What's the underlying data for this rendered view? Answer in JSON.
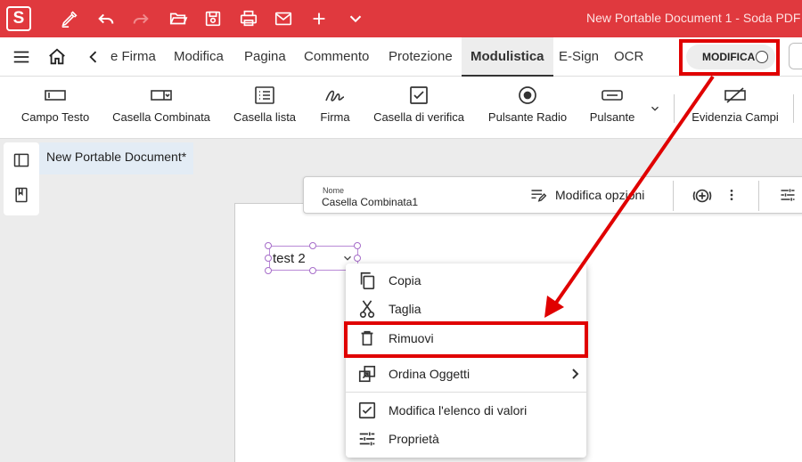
{
  "titlebar": {
    "logo_letter": "S",
    "doc_title": "New Portable Document 1  -  Soda PDF",
    "bg_color": "#e0393e"
  },
  "quick_access": [
    "sign-pen-icon",
    "undo-icon",
    "redo-icon",
    "open-folder-icon",
    "save-icon",
    "print-icon",
    "mail-icon",
    "plus-icon",
    "chevron-down-icon"
  ],
  "menubar": {
    "tabs": [
      "e Firma",
      "Modifica",
      "Pagina",
      "Commento",
      "Protezione",
      "Modulistica",
      "E-Sign",
      "OCR"
    ],
    "active_tab": "Modulistica",
    "mode_toggle_label": "MODIFICA"
  },
  "toolbar": {
    "tools": [
      "Campo Testo",
      "Casella Combinata",
      "Casella lista",
      "Firma",
      "Casella di verifica",
      "Pulsante Radio",
      "Pulsante",
      "Evidenzia Campi"
    ]
  },
  "document": {
    "tab_title": "New Portable Document*"
  },
  "field_properties": {
    "name_label": "Nome",
    "name_value": "Casella Combinata1",
    "edit_options_label": "Modifica opzioni"
  },
  "combobox": {
    "value": "test 2"
  },
  "context_menu": {
    "items": [
      {
        "label": "Copia",
        "icon": "copy-icon"
      },
      {
        "label": "Taglia",
        "icon": "scissors-icon"
      },
      {
        "label": "Rimuovi",
        "icon": "trash-icon"
      },
      {
        "label": "Ordina Oggetti",
        "icon": "arrange-icon"
      },
      {
        "label": "Modifica l'elenco di valori",
        "icon": "checkbox-list-icon"
      },
      {
        "label": "Proprietà",
        "icon": "sliders-icon"
      }
    ]
  },
  "annotation_color": "#e00000"
}
